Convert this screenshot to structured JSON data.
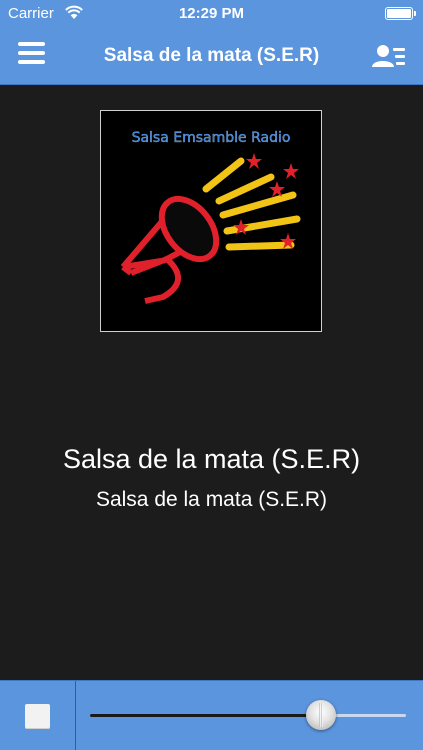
{
  "status_bar": {
    "carrier": "Carrier",
    "time": "12:29 PM",
    "battery_level": 1.0
  },
  "nav": {
    "title": "Salsa de la mata (S.E.R)",
    "left_icon": "menu-icon",
    "right_icon": "contacts-icon"
  },
  "station": {
    "logo_text": "Salsa Emsamble Radio",
    "title": "Salsa de la mata (S.E.R)",
    "subtitle": "Salsa de la mata (S.E.R)"
  },
  "player": {
    "stop_icon": "stop-icon",
    "volume_level": 0.73
  },
  "colors": {
    "accent": "#5b95de",
    "background": "#1c1c1c"
  }
}
